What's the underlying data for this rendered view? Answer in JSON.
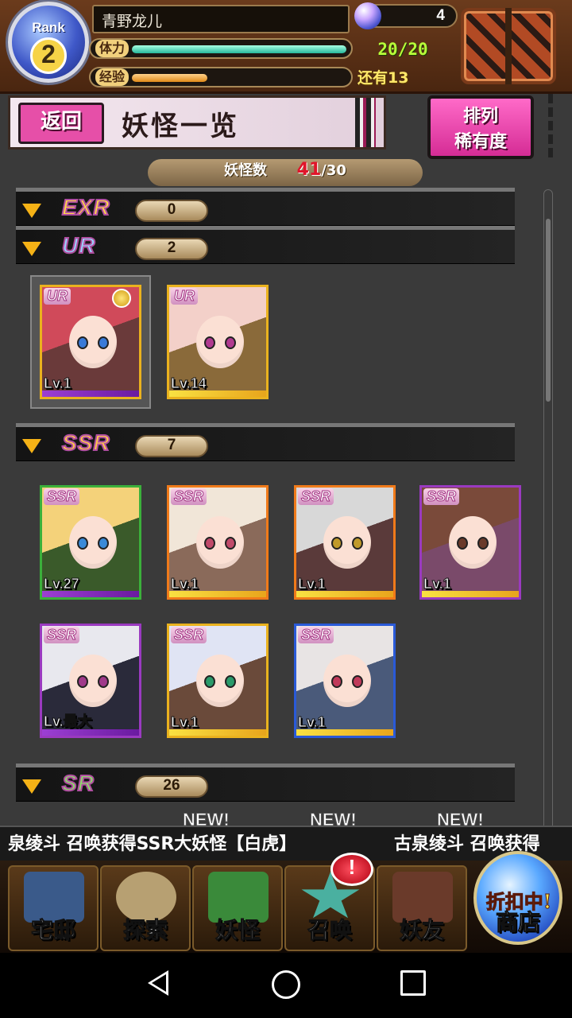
{
  "player": {
    "rank_label": "Rank",
    "rank_value": "2",
    "name": "青野龙儿",
    "gems": "4"
  },
  "stamina": {
    "label": "体力",
    "value": "20/20",
    "fraction": 1.0
  },
  "experience": {
    "label": "经验",
    "remaining": "还有13",
    "fraction": 0.35
  },
  "header": {
    "back_label": "返回",
    "title": "妖怪一览",
    "sort_line1": "排列",
    "sort_line2": "稀有度"
  },
  "monster_count": {
    "label": "妖怪数",
    "current": "41",
    "max": "/30"
  },
  "sections": [
    {
      "rarity": "EXR",
      "count": "0",
      "color": "#ffd84a"
    },
    {
      "rarity": "UR",
      "count": "2",
      "color": "#9ad7ff"
    },
    {
      "rarity": "SSR",
      "count": "7",
      "color": "#ffcc4a"
    },
    {
      "rarity": "SR",
      "count": "26",
      "color": "#8ce06a"
    }
  ],
  "ur_cards": [
    {
      "badge": "UR",
      "level": "Lv.1",
      "frame": "#eab21e",
      "hair": "#d04a5a",
      "eyes": "#3a7ad8",
      "bg": "#6a3a3a",
      "bar": "purple"
    },
    {
      "badge": "UR",
      "level": "Lv.14",
      "frame": "#eab21e",
      "hair": "#f3d0c9",
      "eyes": "#b03a90",
      "bg": "#8a6a3a",
      "bar": "gold"
    }
  ],
  "ssr_cards": [
    {
      "badge": "SSR",
      "level": "Lv.27",
      "frame": "#3bb03b",
      "hair": "#f4d27a",
      "eyes": "#3a8ad8",
      "bg": "#3a5a2a",
      "bar": "purple"
    },
    {
      "badge": "SSR",
      "level": "Lv.1",
      "frame": "#f07a1a",
      "hair": "#f1e6d8",
      "eyes": "#c04a6a",
      "bg": "#8a6a5a",
      "bar": "gold"
    },
    {
      "badge": "SSR",
      "level": "Lv.1",
      "frame": "#f07a1a",
      "hair": "#d8d8d8",
      "eyes": "#c09a2a",
      "bg": "#5a3a3a",
      "bar": "gold"
    },
    {
      "badge": "SSR",
      "level": "Lv.1",
      "frame": "#9a3ac0",
      "hair": "#7a4a3a",
      "eyes": "#6a3a2a",
      "bg": "#7a4a6a",
      "bar": "gold"
    },
    {
      "badge": "SSR",
      "level": "Lv.最大",
      "frame": "#9a3ac0",
      "hair": "#e8e8ee",
      "eyes": "#a03a8a",
      "bg": "#2a2a3a",
      "bar": "purple"
    },
    {
      "badge": "SSR",
      "level": "Lv.1",
      "frame": "#eab21e",
      "hair": "#e0e4f4",
      "eyes": "#2a9a6a",
      "bg": "#6a4a3a",
      "bar": "gold"
    },
    {
      "badge": "SSR",
      "level": "Lv.1",
      "frame": "#2a5ad8",
      "hair": "#e8e4e4",
      "eyes": "#c03a5a",
      "bg": "#4a5a7a",
      "bar": "gold"
    }
  ],
  "new_labels": [
    "NEW!",
    "NEW!",
    "NEW!"
  ],
  "ticker": {
    "text1": "泉绫斗 召唤获得SSR大妖怪【白虎】",
    "text2": "古泉绫斗 召唤获得"
  },
  "nav": [
    {
      "label": "宅邸",
      "icon": "mansion-icon",
      "color": "#3a5a8a"
    },
    {
      "label": "探索",
      "icon": "magnifier-map-icon",
      "color": "#b7a072"
    },
    {
      "label": "妖怪",
      "icon": "scroll-icon",
      "color": "#3a8a3a"
    },
    {
      "label": "召唤",
      "icon": "pentagram-icon",
      "color": "#4ab0a0"
    },
    {
      "label": "妖友",
      "icon": "cat-girl-icon",
      "color": "#6a3a2a"
    }
  ],
  "summon_alert": "!",
  "shop": {
    "sale_label": "折扣中!",
    "label": "商店"
  }
}
